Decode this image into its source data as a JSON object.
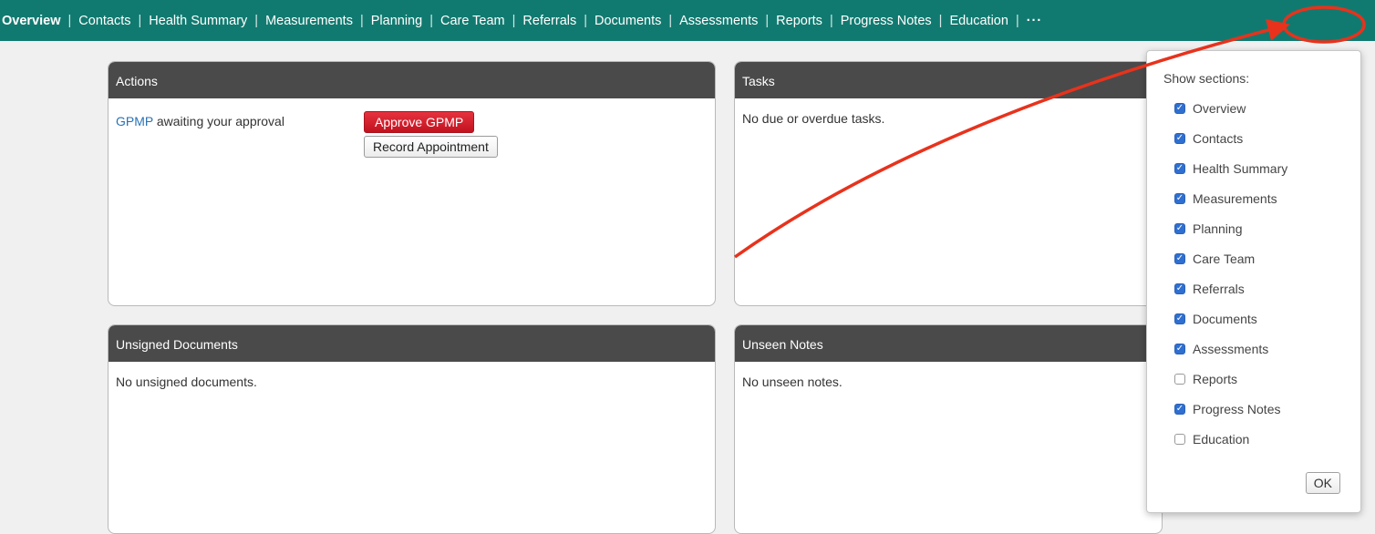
{
  "tabs": {
    "items": [
      "Overview",
      "Contacts",
      "Health Summary",
      "Measurements",
      "Planning",
      "Care Team",
      "Referrals",
      "Documents",
      "Assessments",
      "Reports",
      "Progress Notes",
      "Education"
    ],
    "more_label": "···"
  },
  "actions": {
    "title": "Actions",
    "link": "GPMP",
    "text": " awaiting your approval",
    "approve_label": "Approve GPMP",
    "record_label": "Record Appointment"
  },
  "tasks": {
    "title": "Tasks",
    "empty": "No due or overdue tasks."
  },
  "unsigned": {
    "title": "Unsigned Documents",
    "empty": "No unsigned documents."
  },
  "unseen": {
    "title": "Unseen Notes",
    "empty": "No unseen notes."
  },
  "sections_menu": {
    "title": "Show sections:",
    "items": [
      {
        "label": "Overview",
        "checked": true
      },
      {
        "label": "Contacts",
        "checked": true
      },
      {
        "label": "Health Summary",
        "checked": true
      },
      {
        "label": "Measurements",
        "checked": true
      },
      {
        "label": "Planning",
        "checked": true
      },
      {
        "label": "Care Team",
        "checked": true
      },
      {
        "label": "Referrals",
        "checked": true
      },
      {
        "label": "Documents",
        "checked": true
      },
      {
        "label": "Assessments",
        "checked": true
      },
      {
        "label": "Reports",
        "checked": false
      },
      {
        "label": "Progress Notes",
        "checked": true
      },
      {
        "label": "Education",
        "checked": false
      }
    ],
    "ok_label": "OK"
  },
  "colors": {
    "tabbar": "#117a70",
    "panel_header": "#4a4a4a",
    "approve_button": "#d21f2b",
    "link": "#2a72b5",
    "checkbox": "#2f6fd0",
    "annotation": "#e8321c"
  }
}
